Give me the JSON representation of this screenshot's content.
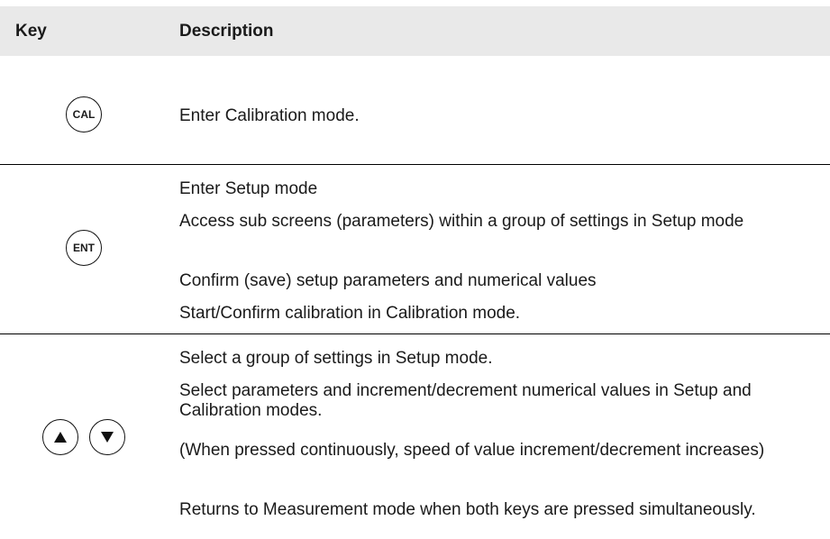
{
  "header": {
    "key": "Key",
    "description": "Description"
  },
  "rows": [
    {
      "key_label": "CAL",
      "lines": [
        "Enter Calibration mode."
      ]
    },
    {
      "key_label": "ENT",
      "lines": [
        "Enter Setup mode",
        "Access sub screens (parameters) within a group of settings in Setup mode",
        "Confirm (save) setup parameters and numerical values",
        "Start/Confirm calibration in Calibration mode."
      ]
    },
    {
      "key_icons": [
        "triangle-up-icon",
        "triangle-down-icon"
      ],
      "lines": [
        "Select a group of settings in Setup mode.",
        "Select parameters and increment/decrement numerical values in Setup and Calibration modes.",
        "(When pressed continuously, speed of value increment/decrement increases)",
        "Returns to Measurement mode when both keys are pressed simultaneously."
      ]
    }
  ]
}
